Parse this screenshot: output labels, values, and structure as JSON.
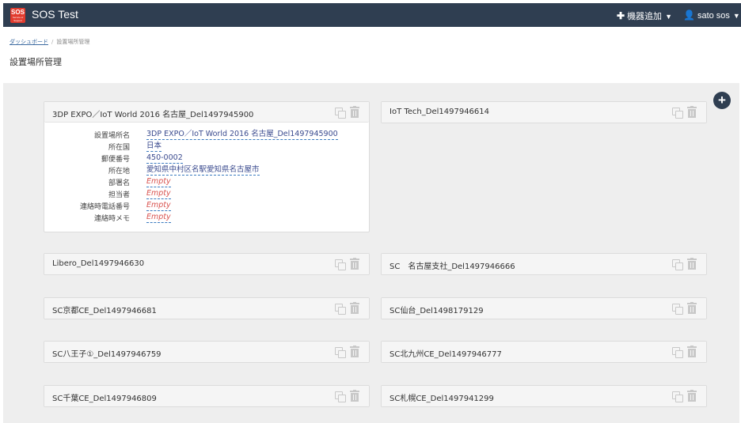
{
  "app": {
    "logo_text": "SOS",
    "logo_sub": "Service of Support",
    "title": "SOS Test"
  },
  "nav": {
    "add_device_label": "機器追加",
    "user_label": "sato sos"
  },
  "breadcrumb": {
    "home": "ダッシュボード",
    "separator": "/",
    "current": "設置場所管理"
  },
  "page": {
    "title": "設置場所管理"
  },
  "expanded_card": {
    "title": "3DP EXPO／IoT World 2016 名古屋_Del1497945900",
    "fields": [
      {
        "label": "設置場所名",
        "value": "3DP EXPO／IoT World 2016 名古屋_Del1497945900"
      },
      {
        "label": "所在国",
        "value": "日本"
      },
      {
        "label": "郵便番号",
        "value": "450-0002"
      },
      {
        "label": "所在地",
        "value": "愛知県中村区名駅愛知県名古屋市"
      },
      {
        "label": "部署名",
        "value": "Empty"
      },
      {
        "label": "担当者",
        "value": "Empty"
      },
      {
        "label": "連絡時電話番号",
        "value": "Empty"
      },
      {
        "label": "連絡時メモ",
        "value": "Empty"
      }
    ]
  },
  "cards": [
    "IoT Tech_Del1497946614",
    "Libero_Del1497946630",
    "SC　名古屋支社_Del1497946666",
    "SC京都CE_Del1497946681",
    "SC仙台_Del1498179129",
    "SC八王子①_Del1497946759",
    "SC北九州CE_Del1497946777",
    "SC千葉CE_Del1497946809",
    "SC札幌CE_Del1497941299"
  ],
  "colors": {
    "navbar": "#2f3e51",
    "logo": "#e23b2e",
    "value_link": "#3a4a8e",
    "empty_value": "#d9534f"
  }
}
